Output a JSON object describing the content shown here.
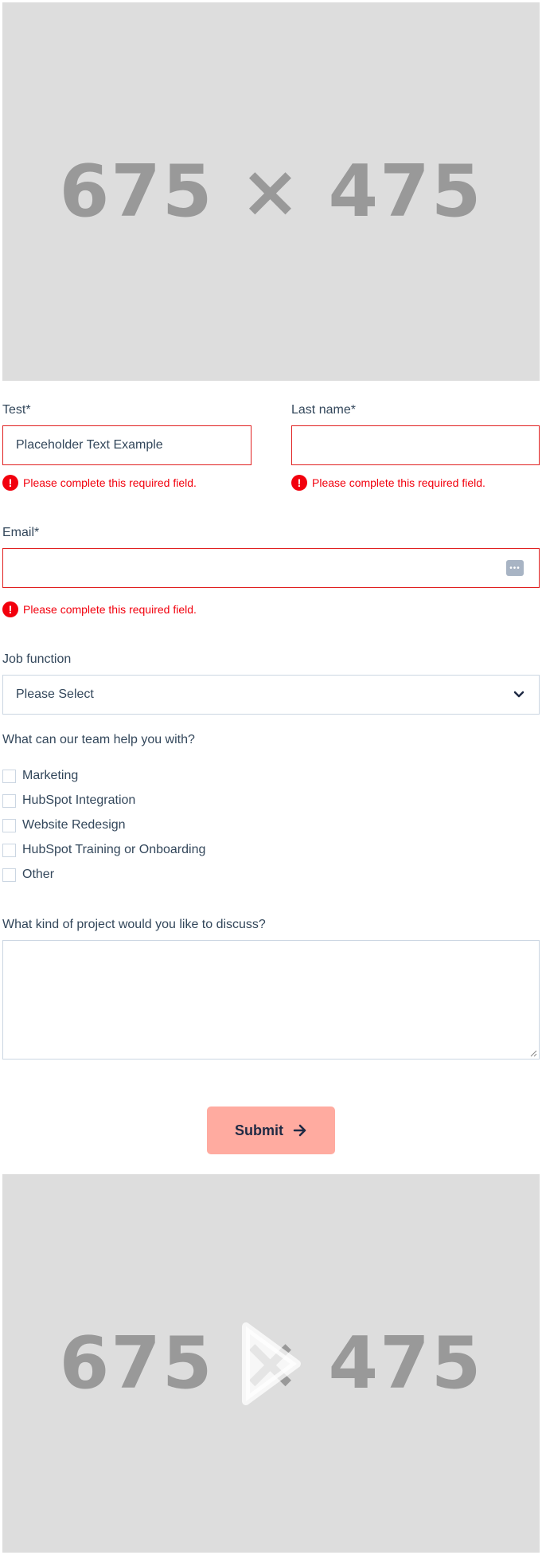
{
  "top_image": {
    "text": "675 × 475"
  },
  "form": {
    "first_name": {
      "label": "Test*",
      "placeholder": "Placeholder Text Example",
      "error": "Please complete this required field."
    },
    "last_name": {
      "label": "Last name*",
      "error": "Please complete this required field."
    },
    "email": {
      "label": "Email*",
      "error": "Please complete this required field."
    },
    "job_function": {
      "label": "Job function",
      "selected": "Please Select"
    },
    "help_with": {
      "label": "What can our team help you with?",
      "options": [
        "Marketing",
        "HubSpot Integration",
        "Website Redesign",
        "HubSpot Training or Onboarding",
        "Other"
      ]
    },
    "project": {
      "label": "What kind of project would you like to discuss?"
    },
    "submit_label": "Submit"
  },
  "bottom_image": {
    "text": "675 × 475"
  },
  "colors": {
    "error": "#f2000d",
    "button": "#ffaba0",
    "placeholder_bg": "#dddddd",
    "placeholder_text": "#999999"
  }
}
